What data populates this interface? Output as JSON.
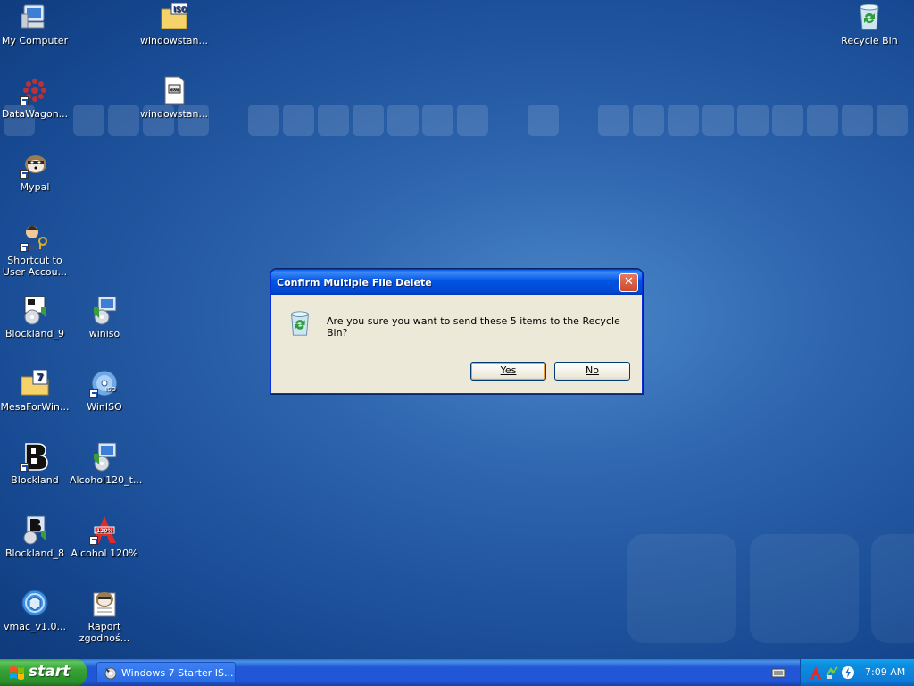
{
  "desktop": {
    "icons": [
      {
        "label": "My Computer",
        "icon": "my-computer-icon"
      },
      {
        "label": "windowstan...",
        "icon": "iso-folder-icon"
      },
      {
        "label": "Recycle Bin",
        "icon": "recycle-bin-icon"
      },
      {
        "label": "DataWagon...",
        "icon": "datawagon-icon"
      },
      {
        "label": "windowstan...",
        "icon": "iso-file-icon"
      },
      {
        "label": "Mypal",
        "icon": "mypal-icon"
      },
      {
        "label": "Shortcut to\nUser Accou...",
        "icon": "user-accounts-icon"
      },
      {
        "label": "Blockland_9",
        "icon": "installer-icon"
      },
      {
        "label": "winiso",
        "icon": "installer-icon"
      },
      {
        "label": "MesaForWin...",
        "icon": "archive-folder-icon"
      },
      {
        "label": "WinISO",
        "icon": "winiso-disc-icon"
      },
      {
        "label": "Blockland",
        "icon": "blockland-icon"
      },
      {
        "label": "Alcohol120_t...",
        "icon": "installer-icon"
      },
      {
        "label": "Blockland_8",
        "icon": "installer-icon"
      },
      {
        "label": "Alcohol 120%",
        "icon": "alcohol-icon"
      },
      {
        "label": "vmac_v1.0...",
        "icon": "vmac-icon"
      },
      {
        "label": "Raport\nzgodnoś...",
        "icon": "raport-icon"
      }
    ]
  },
  "dialog": {
    "title": "Confirm Multiple File Delete",
    "message": "Are you sure you want to send these 5 items to the Recycle Bin?",
    "yes_label": "Yes",
    "no_label": "No",
    "close_symbol": "✕"
  },
  "taskbar": {
    "start_label": "start",
    "task_label": "Windows 7 Starter IS...",
    "clock": "7:09 AM"
  },
  "colors": {
    "desktop_blue": "#2d64ad",
    "titlebar_blue": "#0054e3",
    "start_green": "#37a337",
    "dialog_face": "#ece9d8"
  }
}
